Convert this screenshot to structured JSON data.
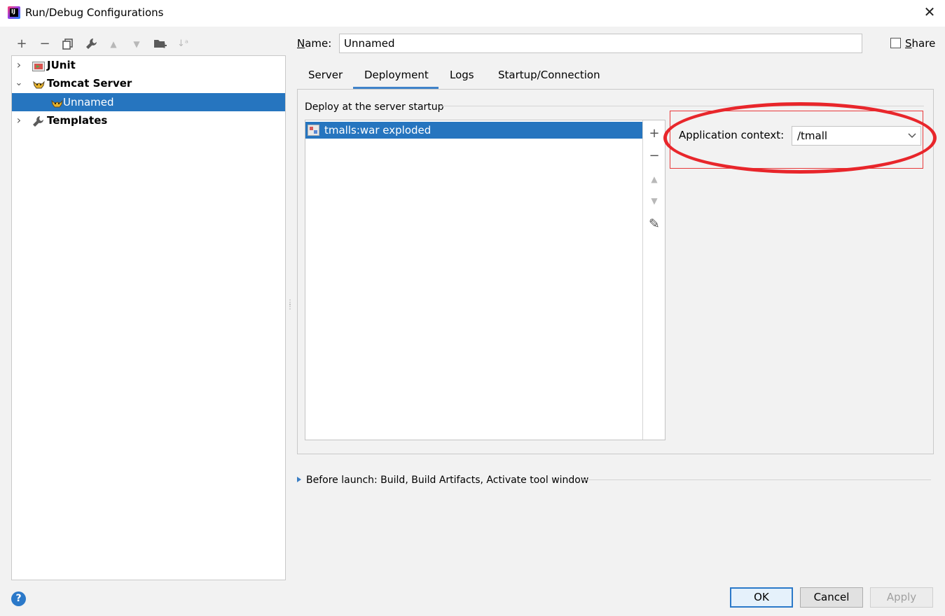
{
  "window": {
    "title": "Run/Debug Configurations",
    "close_glyph": "✕"
  },
  "toolbar": {
    "add": "+",
    "remove": "−",
    "copy": "⧉",
    "edit_defaults": "🔧",
    "move_up": "▲",
    "move_down": "▼",
    "new_folder": "📁",
    "sort": "↓ᵃ"
  },
  "tree": {
    "items": [
      {
        "label": "JUnit",
        "expanded": false
      },
      {
        "label": "Tomcat Server",
        "expanded": true
      },
      {
        "label": "Unnamed",
        "selected": true
      },
      {
        "label": "Templates",
        "expanded": false
      }
    ],
    "chev_collapsed": "›",
    "chev_expanded": "⌄"
  },
  "form": {
    "name_label_prefix": "N",
    "name_label_rest": "ame:",
    "name_value": "Unnamed",
    "share_prefix": "S",
    "share_rest": "hare"
  },
  "tabs": [
    {
      "label": "Server"
    },
    {
      "label": "Deployment",
      "active": true
    },
    {
      "label": "Logs"
    },
    {
      "label": "Startup/Connection"
    }
  ],
  "deployment": {
    "group_title": "Deploy at the server startup",
    "artifacts": [
      "tmalls:war exploded"
    ],
    "side_buttons": {
      "add": "+",
      "remove": "−",
      "up": "▲",
      "down": "▼",
      "edit": "✎"
    },
    "app_context_label": "Application context:",
    "app_context_value": "/tmall"
  },
  "before_launch": {
    "text": "Before launch: Build, Build Artifacts, Activate tool window"
  },
  "footer": {
    "help": "?",
    "ok": "OK",
    "cancel": "Cancel",
    "apply": "Apply"
  },
  "colors": {
    "selection": "#2675bf",
    "accent": "#4083c9",
    "annotation_red": "#e8262b"
  }
}
